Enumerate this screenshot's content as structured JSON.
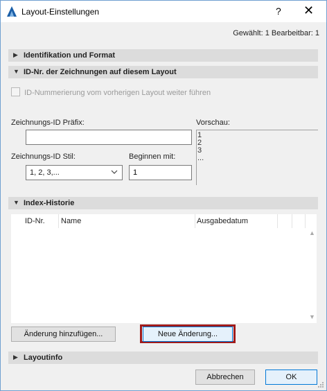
{
  "window": {
    "title": "Layout-Einstellungen",
    "help_glyph": "?",
    "close_glyph": "✕"
  },
  "selection_info": "Gewählt: 1 Bearbeitbar: 1",
  "sections": {
    "identification": {
      "label": "Identifikation und Format",
      "arrow": "▶"
    },
    "drawing_ids": {
      "label": "ID-Nr. der Zeichnungen auf diesem Layout",
      "arrow": "▼"
    },
    "index_history": {
      "label": "Index-Historie",
      "arrow": "▼"
    },
    "layout_info": {
      "label": "Layoutinfo",
      "arrow": "▶"
    }
  },
  "drawing_ids": {
    "continue_checkbox_label": "ID-Nummerierung vom vorherigen Layout weiter führen",
    "continue_checked": false,
    "prefix_label": "Zeichnungs-ID Präfix:",
    "prefix_value": "",
    "style_label": "Zeichnungs-ID Stil:",
    "style_value": "1, 2, 3,...",
    "start_label": "Beginnen mit:",
    "start_value": "1",
    "preview_label": "Vorschau:",
    "preview_lines": [
      "1",
      "2",
      "3",
      "..."
    ]
  },
  "index_history": {
    "columns": [
      "ID-Nr.",
      "Name",
      "Ausgabedatum"
    ],
    "rows": [],
    "scroll_up_glyph": "▲",
    "scroll_down_glyph": "▼"
  },
  "buttons": {
    "add_revision": "Änderung hinzufügen...",
    "new_revision": "Neue Änderung...",
    "cancel": "Abbrechen",
    "ok": "OK"
  },
  "colors": {
    "accent_border": "#0078d7",
    "highlight_frame": "#a01b1b",
    "section_header_bg": "#dcdcdc"
  },
  "icons": {
    "app": "archicad-logo-icon",
    "dropdown": "chevron-down-icon",
    "resize": "resize-grip-icon"
  }
}
